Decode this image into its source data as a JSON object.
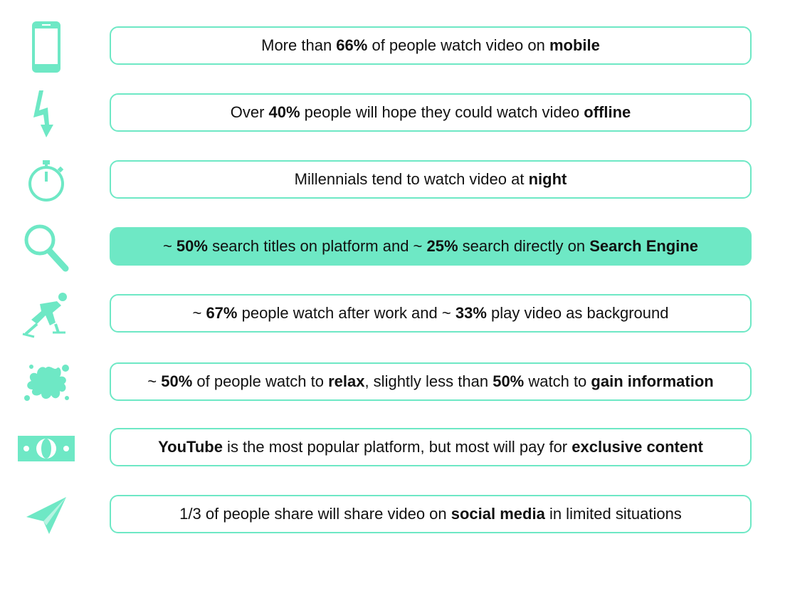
{
  "accent_color": "#6ee8c5",
  "rows": [
    {
      "icon": "mobile-phone-icon",
      "highlight": false,
      "segments": [
        {
          "t": "More than ",
          "b": false
        },
        {
          "t": "66%",
          "b": true
        },
        {
          "t": " of people watch video on ",
          "b": false
        },
        {
          "t": "mobile",
          "b": true
        }
      ]
    },
    {
      "icon": "lightning-bolt-icon",
      "highlight": false,
      "segments": [
        {
          "t": "Over ",
          "b": false
        },
        {
          "t": "40%",
          "b": true
        },
        {
          "t": " people will hope they could watch video ",
          "b": false
        },
        {
          "t": "offline",
          "b": true
        }
      ]
    },
    {
      "icon": "stopwatch-icon",
      "highlight": false,
      "segments": [
        {
          "t": "Millennials tend to watch video at ",
          "b": false
        },
        {
          "t": "night",
          "b": true
        }
      ]
    },
    {
      "icon": "magnifier-icon",
      "highlight": true,
      "segments": [
        {
          "t": "~ ",
          "b": false
        },
        {
          "t": "50%",
          "b": true
        },
        {
          "t": " search titles on platform and ~ ",
          "b": false
        },
        {
          "t": "25%",
          "b": true
        },
        {
          "t": " search directly on ",
          "b": false
        },
        {
          "t": "Search Engine",
          "b": true
        }
      ]
    },
    {
      "icon": "skater-icon",
      "highlight": false,
      "segments": [
        {
          "t": "~ ",
          "b": false
        },
        {
          "t": "67%",
          "b": true
        },
        {
          "t": " people watch after work and ~ ",
          "b": false
        },
        {
          "t": "33%",
          "b": true
        },
        {
          "t": " play video as background",
          "b": false
        }
      ]
    },
    {
      "icon": "splash-icon",
      "highlight": false,
      "segments": [
        {
          "t": "~ ",
          "b": false
        },
        {
          "t": "50%",
          "b": true
        },
        {
          "t": " of people watch to ",
          "b": false
        },
        {
          "t": "relax",
          "b": true
        },
        {
          "t": ", slightly less than ",
          "b": false
        },
        {
          "t": "50%",
          "b": true
        },
        {
          "t": " watch to ",
          "b": false
        },
        {
          "t": "gain information",
          "b": true
        }
      ]
    },
    {
      "icon": "money-bill-icon",
      "highlight": false,
      "segments": [
        {
          "t": "YouTube",
          "b": true
        },
        {
          "t": " is the most popular platform, but most will pay for ",
          "b": false
        },
        {
          "t": "exclusive content",
          "b": true
        }
      ]
    },
    {
      "icon": "paper-plane-icon",
      "highlight": false,
      "segments": [
        {
          "t": "1/3 of people share will share video on ",
          "b": false
        },
        {
          "t": "social media",
          "b": true
        },
        {
          "t": " in limited situations",
          "b": false
        }
      ]
    }
  ]
}
